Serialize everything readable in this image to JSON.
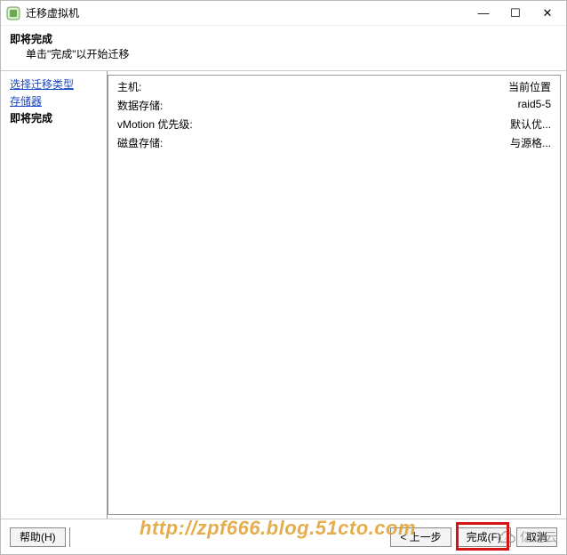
{
  "titlebar": {
    "title": "迁移虚拟机"
  },
  "header": {
    "title": "即将完成",
    "subtitle": "单击\"完成\"以开始迁移"
  },
  "sidebar": {
    "items": [
      {
        "label": "选择迁移类型",
        "current": false
      },
      {
        "label": "存储器",
        "current": false
      },
      {
        "label": "即将完成",
        "current": true
      }
    ]
  },
  "summary": {
    "rows": [
      {
        "label": "主机:",
        "value": "当前位置"
      },
      {
        "label": "数据存储:",
        "value": "raid5-5"
      },
      {
        "label": "vMotion 优先级:",
        "value": "默认优..."
      },
      {
        "label": "磁盘存储:",
        "value": "与源格..."
      }
    ]
  },
  "footer": {
    "help": "帮助(H)",
    "back": "< 上一步",
    "finish": "完成(F)",
    "cancel": "取消"
  },
  "watermark": {
    "url": "http://zpf666.blog.51cto.com",
    "brand": "亿速云"
  }
}
